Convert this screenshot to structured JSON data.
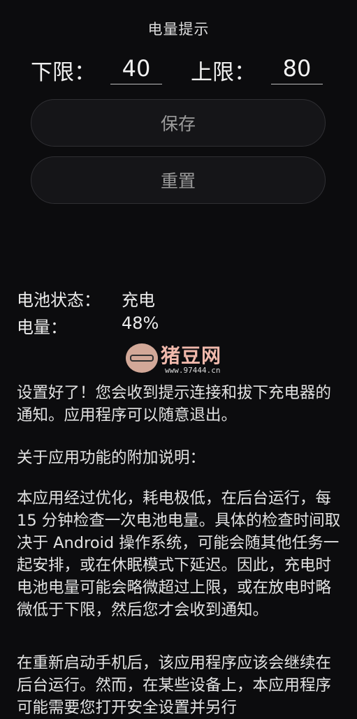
{
  "header": {
    "title": "电量提示"
  },
  "limits": {
    "lower_label": "下限：",
    "lower_value": "40",
    "upper_label": "上限：",
    "upper_value": "80"
  },
  "buttons": {
    "save_label": "保存",
    "reset_label": "重置"
  },
  "status": {
    "battery_state_label": "电池状态：",
    "battery_state_value": "充电",
    "level_label": "电量：",
    "level_value": "48%"
  },
  "watermark": {
    "text": "猪豆网",
    "url": "www.97444.cn"
  },
  "info": {
    "paragraph1": "设置好了！您会收到提示连接和拔下充电器的通知。应用程序可以随意退出。",
    "paragraph2": "关于应用功能的附加说明：",
    "paragraph3": "本应用经过优化，耗电极低，在后台运行，每 15 分钟检查一次电池电量。具体的检查时间取决于 Android 操作系统，可能会随其他任务一起安排，或在休眠模式下延迟。因此，充电时电池电量可能会略微超过上限，或在放电时略微低于下限，然后您才会收到通知。",
    "paragraph4": "在重新启动手机后，该应用程序应该会继续在后台运行。然而，在某些设备上，本应用程序可能需要您打开安全设置并另行"
  }
}
